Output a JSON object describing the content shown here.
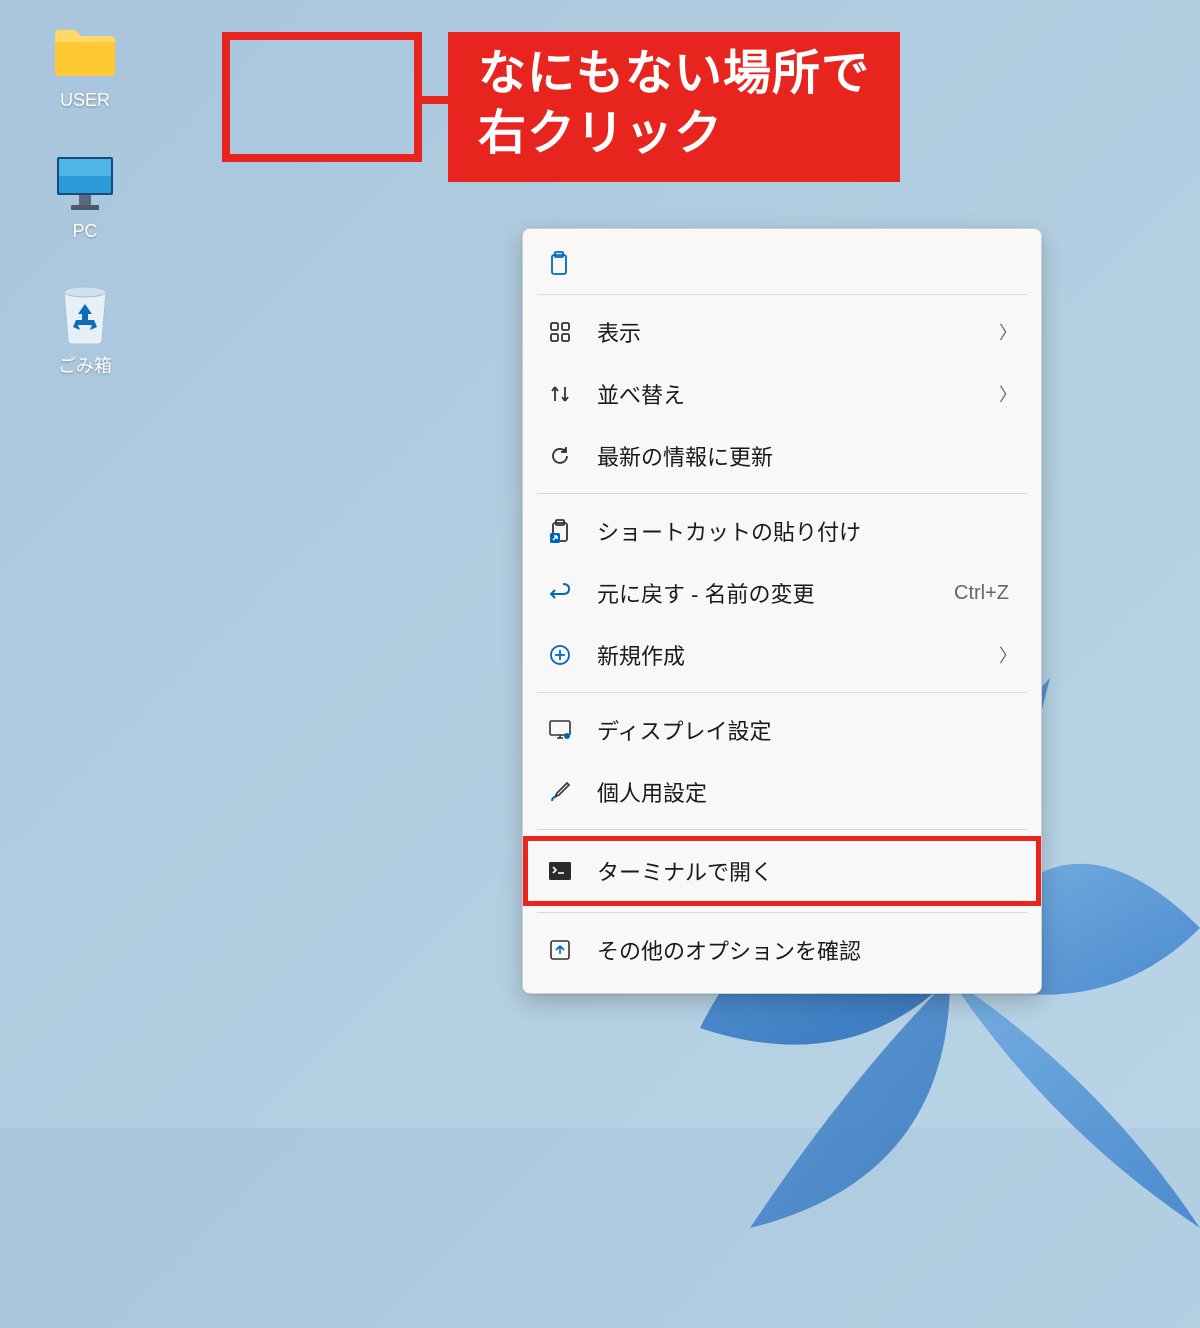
{
  "desktop": {
    "icons": [
      {
        "label": "USER"
      },
      {
        "label": "PC"
      },
      {
        "label": "ごみ箱"
      }
    ]
  },
  "annotation": {
    "text": "なにもない場所で\n右クリック"
  },
  "context_menu": {
    "items": {
      "view": {
        "label": "表示",
        "has_submenu": true
      },
      "sort": {
        "label": "並べ替え",
        "has_submenu": true
      },
      "refresh": {
        "label": "最新の情報に更新"
      },
      "paste_shortcut": {
        "label": "ショートカットの貼り付け"
      },
      "undo": {
        "label": "元に戻す - 名前の変更",
        "shortcut": "Ctrl+Z"
      },
      "new": {
        "label": "新規作成",
        "has_submenu": true
      },
      "display_settings": {
        "label": "ディスプレイ設定"
      },
      "personalize": {
        "label": "個人用設定"
      },
      "terminal": {
        "label": "ターミナルで開く"
      },
      "more_options": {
        "label": "その他のオプションを確認"
      }
    }
  }
}
